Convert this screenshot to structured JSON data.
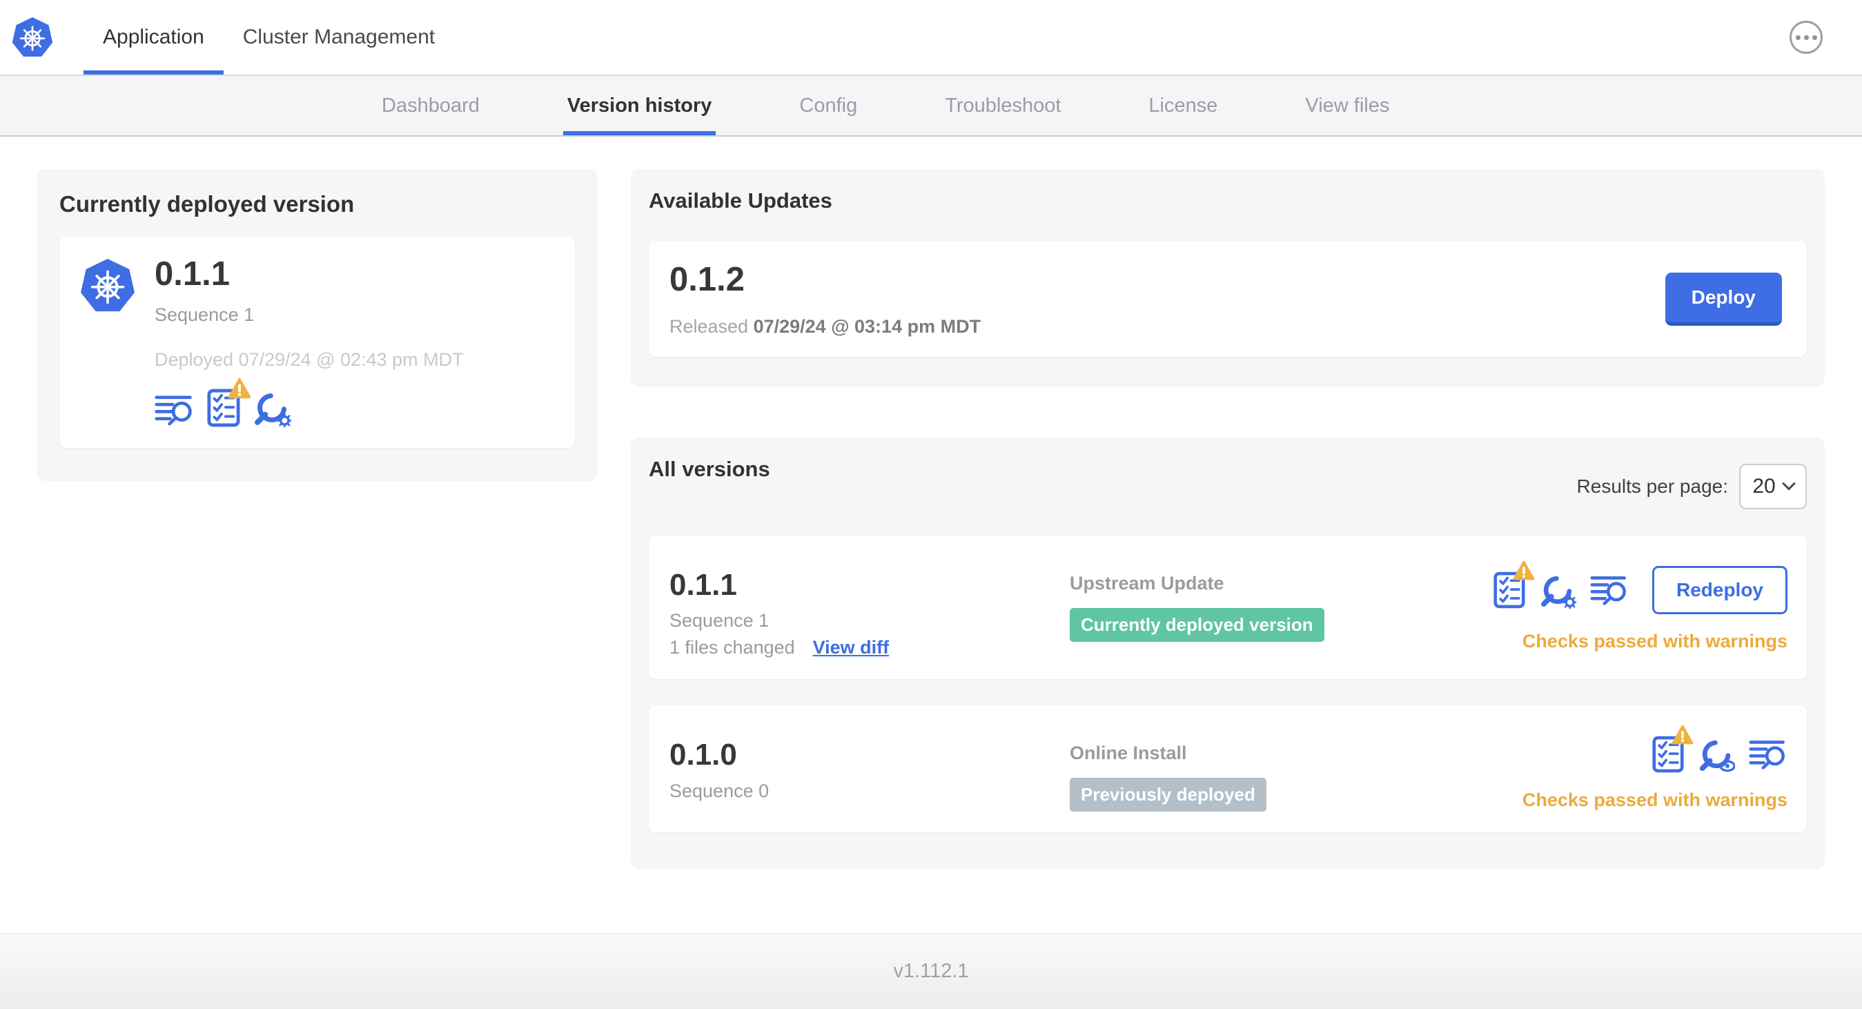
{
  "header": {
    "tabs": [
      {
        "label": "Application",
        "active": true
      },
      {
        "label": "Cluster Management",
        "active": false
      }
    ]
  },
  "subnav": {
    "tabs": [
      {
        "label": "Dashboard",
        "active": false
      },
      {
        "label": "Version history",
        "active": true
      },
      {
        "label": "Config",
        "active": false
      },
      {
        "label": "Troubleshoot",
        "active": false
      },
      {
        "label": "License",
        "active": false
      },
      {
        "label": "View files",
        "active": false
      }
    ]
  },
  "currently_deployed": {
    "title": "Currently deployed version",
    "version": "0.1.1",
    "sequence": "Sequence 1",
    "deployed_at": "Deployed 07/29/24 @ 02:43 pm MDT"
  },
  "available_updates": {
    "title": "Available Updates",
    "version": "0.1.2",
    "released_prefix": "Released",
    "released_date": "07/29/24 @ 03:14 pm MDT",
    "deploy_label": "Deploy"
  },
  "all_versions": {
    "title": "All versions",
    "results_per_page_label": "Results per page:",
    "results_per_page_value": "20",
    "rows": [
      {
        "version": "0.1.1",
        "sequence": "Sequence 1",
        "files_changed": "1 files changed",
        "view_diff_label": "View diff",
        "source": "Upstream Update",
        "badge": "Currently deployed version",
        "badge_color": "#5fc6a1",
        "checks_text": "Checks passed with warnings",
        "action_label": "Redeploy"
      },
      {
        "version": "0.1.0",
        "sequence": "Sequence 0",
        "source": "Online Install",
        "badge": "Previously deployed",
        "badge_color": "#b4bfc7",
        "checks_text": "Checks passed with warnings"
      }
    ]
  },
  "footer": {
    "version": "v1.112.1"
  },
  "colors": {
    "accent_blue": "#3e6de4",
    "kubernetes_blue": "#3e6de4",
    "warning_gold": "#edaa3c",
    "badge_green": "#5fc6a1",
    "badge_gray": "#b4bfc7",
    "card_gray": "#f5f6f8"
  }
}
